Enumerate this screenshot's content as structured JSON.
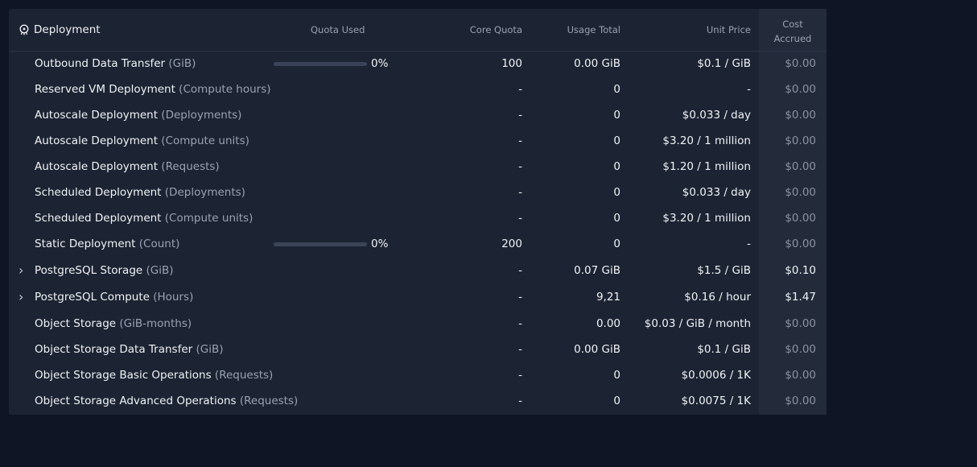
{
  "header": {
    "title": "Deployment",
    "quota_used": "Quota Used",
    "core_quota": "Core Quota",
    "usage_total": "Usage Total",
    "unit_price": "Unit Price",
    "cost_accrued_1": "Cost",
    "cost_accrued_2": "Accrued"
  },
  "colors": {
    "page_bg": "#0f1524",
    "panel_bg": "#1c2332",
    "muted_text": "#9aa3b2",
    "bar_track": "#3b4457"
  },
  "rows": [
    {
      "name": "Outbound Data Transfer",
      "unit": "(GiB)",
      "expandable": false,
      "quota_pct_label": "0%",
      "quota_fraction": 0,
      "core_quota": "100",
      "usage": "0.00 GiB",
      "price": "$0.1 / GiB",
      "cost": "$0.00"
    },
    {
      "name": "Reserved VM Deployment",
      "unit": "(Compute hours)",
      "expandable": false,
      "quota_pct_label": null,
      "core_quota": "-",
      "usage": "0",
      "price": "-",
      "cost": "$0.00"
    },
    {
      "name": "Autoscale Deployment",
      "unit": "(Deployments)",
      "expandable": false,
      "quota_pct_label": null,
      "core_quota": "-",
      "usage": "0",
      "price": "$0.033 / day",
      "cost": "$0.00"
    },
    {
      "name": "Autoscale Deployment",
      "unit": "(Compute units)",
      "expandable": false,
      "quota_pct_label": null,
      "core_quota": "-",
      "usage": "0",
      "price": "$3.20 / 1 million",
      "cost": "$0.00"
    },
    {
      "name": "Autoscale Deployment",
      "unit": "(Requests)",
      "expandable": false,
      "quota_pct_label": null,
      "core_quota": "-",
      "usage": "0",
      "price": "$1.20 / 1 million",
      "cost": "$0.00"
    },
    {
      "name": "Scheduled Deployment",
      "unit": "(Deployments)",
      "expandable": false,
      "quota_pct_label": null,
      "core_quota": "-",
      "usage": "0",
      "price": "$0.033 / day",
      "cost": "$0.00"
    },
    {
      "name": "Scheduled Deployment",
      "unit": "(Compute units)",
      "expandable": false,
      "quota_pct_label": null,
      "core_quota": "-",
      "usage": "0",
      "price": "$3.20 / 1 million",
      "cost": "$0.00"
    },
    {
      "name": "Static Deployment",
      "unit": "(Count)",
      "expandable": false,
      "quota_pct_label": "0%",
      "quota_fraction": 0,
      "core_quota": "200",
      "usage": "0",
      "price": "-",
      "cost": "$0.00"
    },
    {
      "name": "PostgreSQL Storage",
      "unit": "(GiB)",
      "expandable": true,
      "quota_pct_label": null,
      "core_quota": "-",
      "usage": "0.07 GiB",
      "price": "$1.5 / GiB",
      "cost": "$0.10"
    },
    {
      "name": "PostgreSQL Compute",
      "unit": "(Hours)",
      "expandable": true,
      "quota_pct_label": null,
      "core_quota": "-",
      "usage": "9,21",
      "price": "$0.16 / hour",
      "cost": "$1.47"
    },
    {
      "name": "Object Storage",
      "unit": "(GiB-months)",
      "expandable": false,
      "quota_pct_label": null,
      "core_quota": "-",
      "usage": "0.00",
      "price": "$0.03 / GiB / month",
      "cost": "$0.00"
    },
    {
      "name": "Object Storage Data Transfer",
      "unit": "(GiB)",
      "expandable": false,
      "quota_pct_label": null,
      "core_quota": "-",
      "usage": "0.00 GiB",
      "price": "$0.1 / GiB",
      "cost": "$0.00"
    },
    {
      "name": "Object Storage Basic Operations",
      "unit": "(Requests)",
      "expandable": false,
      "quota_pct_label": null,
      "core_quota": "-",
      "usage": "0",
      "price": "$0.0006 / 1K",
      "cost": "$0.00"
    },
    {
      "name": "Object Storage Advanced Operations",
      "unit": "(Requests)",
      "expandable": false,
      "quota_pct_label": null,
      "core_quota": "-",
      "usage": "0",
      "price": "$0.0075 / 1K",
      "cost": "$0.00"
    }
  ]
}
